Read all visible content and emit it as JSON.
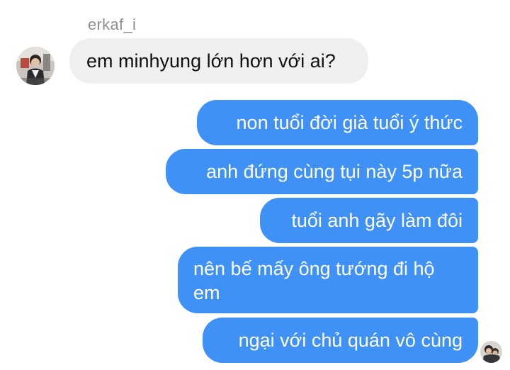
{
  "chat": {
    "sender_name": "erkaf_i",
    "incoming_message": "em minhyung lớn hơn với ai?",
    "outgoing_messages": [
      "non tuổi đời già tuổi ý thức",
      "anh đứng cùng tụi này 5p nữa",
      "tuổi anh gãy làm đôi",
      "nên bế mấy ông tướng đi hộ em",
      "ngại với chủ quán vô cùng"
    ]
  },
  "colors": {
    "outgoing_bubble": "#3f91f6",
    "incoming_bubble": "#efefef",
    "sender_name": "#8e8e93"
  },
  "icons": {
    "sender_avatar": "avatar-photo",
    "own_avatar": "avatar-photo"
  }
}
